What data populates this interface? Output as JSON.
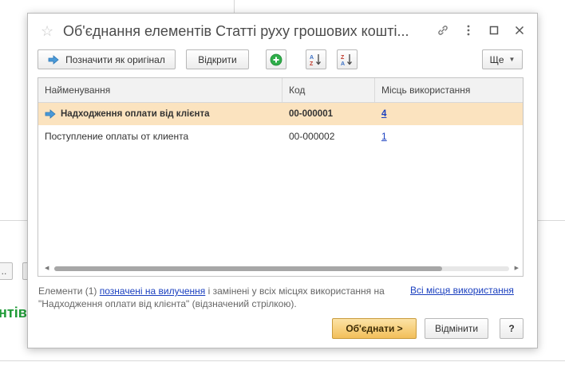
{
  "background": {
    "small_button_label": "..",
    "partial_heading": "нтів"
  },
  "dialog": {
    "title": "Об'єднання елементів Статті руху грошових кошті...",
    "icons": {
      "favorite": "star-icon",
      "link": "link-icon",
      "menu": "vertical-dots-icon",
      "maximize": "maximize-icon",
      "close": "close-icon"
    }
  },
  "toolbar": {
    "mark_original_label": "Позначити як оригінал",
    "open_label": "Відкрити",
    "more_label": "Ще",
    "add_icon": "plus-circle-icon",
    "sort_asc_icon": "sort-az-icon",
    "sort_desc_icon": "sort-za-icon"
  },
  "table": {
    "columns": [
      "Найменування",
      "Код",
      "Місць використання"
    ],
    "rows": [
      {
        "name": "Надходження оплати від клієнта",
        "code": "00-000001",
        "usage": "4",
        "selected": true
      },
      {
        "name": "Поступление оплаты от клиента",
        "code": "00-000002",
        "usage": "1",
        "selected": false
      }
    ]
  },
  "info": {
    "part1": "Елементи (1) ",
    "link": "позначені на вилучення",
    "part2": " і замінені у всіх місцях використання на \"Надходження оплати від клієнта\" (відзначений стрілкою).",
    "all_places_link": "Всі місця використання"
  },
  "footer": {
    "merge_label": "Об'єднати >",
    "cancel_label": "Відмінити",
    "help_label": "?"
  },
  "colors": {
    "selected_row": "#fbe3bf",
    "primary_button": "#f2bf5a",
    "link": "#1a3fbf",
    "add_icon": "#2fae4a",
    "arrow": "#4a9ad8"
  }
}
